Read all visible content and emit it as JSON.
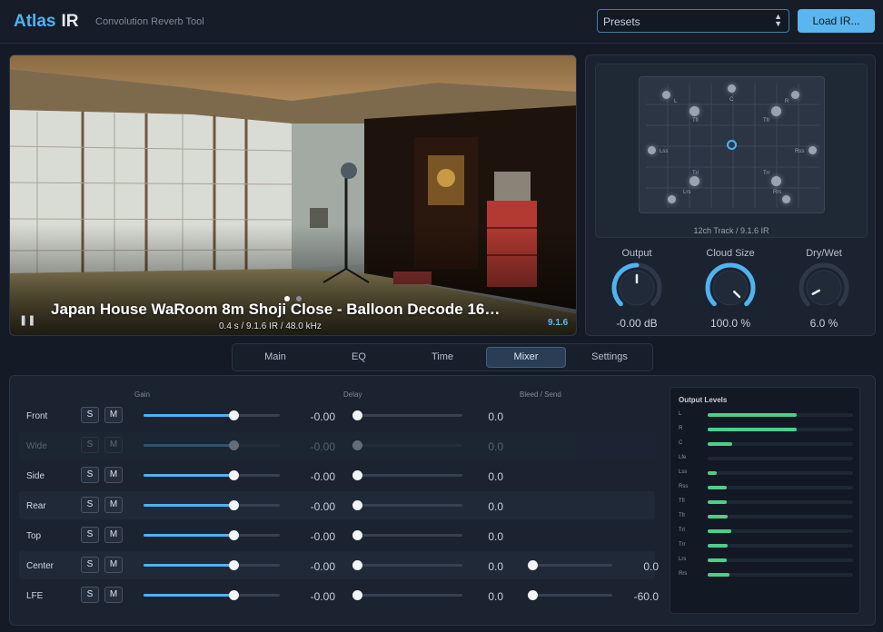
{
  "app": {
    "name_part1": "Atlas",
    "name_part2": "IR",
    "subtitle": "Convolution Reverb Tool"
  },
  "header": {
    "presets_label": "Presets",
    "load_button": "Load IR..."
  },
  "ir": {
    "title": "Japan House WaRoom 8m Shoji Close - Balloon Decode 16…",
    "meta": "0.4 s  /  9.1.6 IR  /  48.0 kHz",
    "format_badge": "9.1.6",
    "carousel_count": 2,
    "carousel_active": 0
  },
  "speakers": {
    "caption": "12ch Track / 9.1.6 IR",
    "labels": [
      "L",
      "C",
      "R",
      "Tfl",
      "Tfr",
      "Lss",
      "Rss",
      "Trl",
      "Trr",
      "Lrs",
      "Rrs"
    ]
  },
  "knobs": [
    {
      "label": "Output",
      "value": "-0.00 dB",
      "fraction": 0.5,
      "accent": true
    },
    {
      "label": "Cloud Size",
      "value": "100.0 %",
      "fraction": 1.0,
      "accent": true
    },
    {
      "label": "Dry/Wet",
      "value": "6.0 %",
      "fraction": 0.06,
      "accent": false
    }
  ],
  "tabs": [
    "Main",
    "EQ",
    "Time",
    "Mixer",
    "Settings"
  ],
  "active_tab": "Mixer",
  "mixer": {
    "headers": {
      "gain": "Gain",
      "delay": "Delay",
      "bleed": "Bleed / Send"
    },
    "solo_label": "S",
    "mute_label": "M",
    "channels": [
      {
        "name": "Front",
        "gain": "-0.00",
        "gain_frac": 0.66,
        "delay": "0.0",
        "bleed": null,
        "bleed_frac": null,
        "enabled": true
      },
      {
        "name": "Wide",
        "gain": "-0.00",
        "gain_frac": 0.66,
        "delay": "0.0",
        "bleed": null,
        "bleed_frac": null,
        "enabled": false
      },
      {
        "name": "Side",
        "gain": "-0.00",
        "gain_frac": 0.66,
        "delay": "0.0",
        "bleed": null,
        "bleed_frac": null,
        "enabled": true
      },
      {
        "name": "Rear",
        "gain": "-0.00",
        "gain_frac": 0.66,
        "delay": "0.0",
        "bleed": null,
        "bleed_frac": null,
        "enabled": true
      },
      {
        "name": "Top",
        "gain": "-0.00",
        "gain_frac": 0.66,
        "delay": "0.0",
        "bleed": null,
        "bleed_frac": null,
        "enabled": true
      },
      {
        "name": "Center",
        "gain": "-0.00",
        "gain_frac": 0.66,
        "delay": "0.0",
        "bleed": "0.0",
        "bleed_frac": 0.0,
        "enabled": true
      },
      {
        "name": "LFE",
        "gain": "-0.00",
        "gain_frac": 0.66,
        "delay": "0.0",
        "bleed": "-60.0",
        "bleed_frac": 0.0,
        "enabled": true
      }
    ]
  },
  "output_levels": {
    "title": "Output Levels",
    "channels": [
      {
        "name": "L",
        "level": 0.61
      },
      {
        "name": "R",
        "level": 0.61
      },
      {
        "name": "C",
        "level": 0.17
      },
      {
        "name": "Lfe",
        "level": 0.0
      },
      {
        "name": "Lss",
        "level": 0.06
      },
      {
        "name": "Rss",
        "level": 0.13
      },
      {
        "name": "Tfl",
        "level": 0.13
      },
      {
        "name": "Tfr",
        "level": 0.14
      },
      {
        "name": "Trl",
        "level": 0.16
      },
      {
        "name": "Trr",
        "level": 0.14
      },
      {
        "name": "Lrs",
        "level": 0.13
      },
      {
        "name": "Rrs",
        "level": 0.15
      }
    ]
  },
  "colors": {
    "accent": "#4fb3f0",
    "meter": "#4ccf8a",
    "background": "#141b26",
    "panel": "#1b2330"
  }
}
